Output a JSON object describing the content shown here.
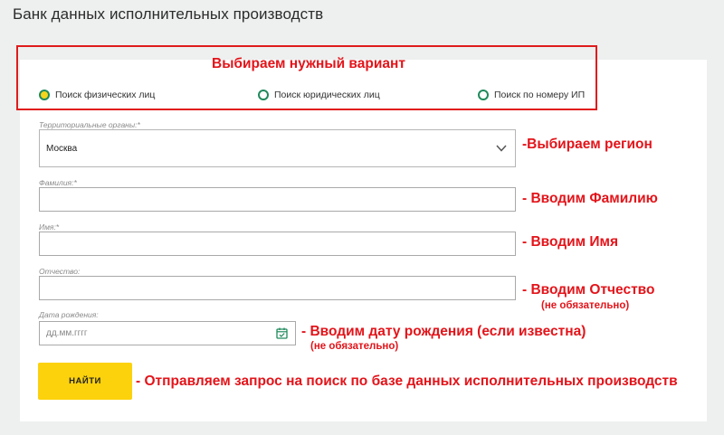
{
  "page": {
    "title": "Банк данных исполнительных производств"
  },
  "search_type": {
    "options": [
      {
        "label": "Поиск физических лиц",
        "checked": true
      },
      {
        "label": "Поиск юридических лиц",
        "checked": false
      },
      {
        "label": "Поиск по номеру ИП",
        "checked": false
      }
    ]
  },
  "form": {
    "region": {
      "label": "Территориальные органы:*",
      "value": "Москва"
    },
    "last_name": {
      "label": "Фамилия:*",
      "value": ""
    },
    "first_name": {
      "label": "Имя:*",
      "value": ""
    },
    "patronymic": {
      "label": "Отчество:",
      "value": ""
    },
    "birth_date": {
      "label": "Дата рождения:",
      "placeholder": "дд.мм.гггг"
    },
    "search_button": "НАЙТИ"
  },
  "annotations": {
    "choose_option": "Выбираем нужный вариант",
    "choose_region": "-Выбираем регион",
    "enter_last_name": "- Вводим Фамилию",
    "enter_first_name": "- Вводим Имя",
    "enter_patronymic": "- Вводим Отчество",
    "optional_1": "(не обязательно)",
    "enter_birth_date": "- Вводим дату рождения (если известна)",
    "optional_2": "(не обязательно)",
    "send_request": "- Отправляем запрос на поиск по базе данных исполнительных производств"
  },
  "colors": {
    "annotation_red": "#e3141a",
    "radio_green": "#1f8a5c",
    "button_yellow": "#fbd20c",
    "background": "#edf0ef"
  }
}
